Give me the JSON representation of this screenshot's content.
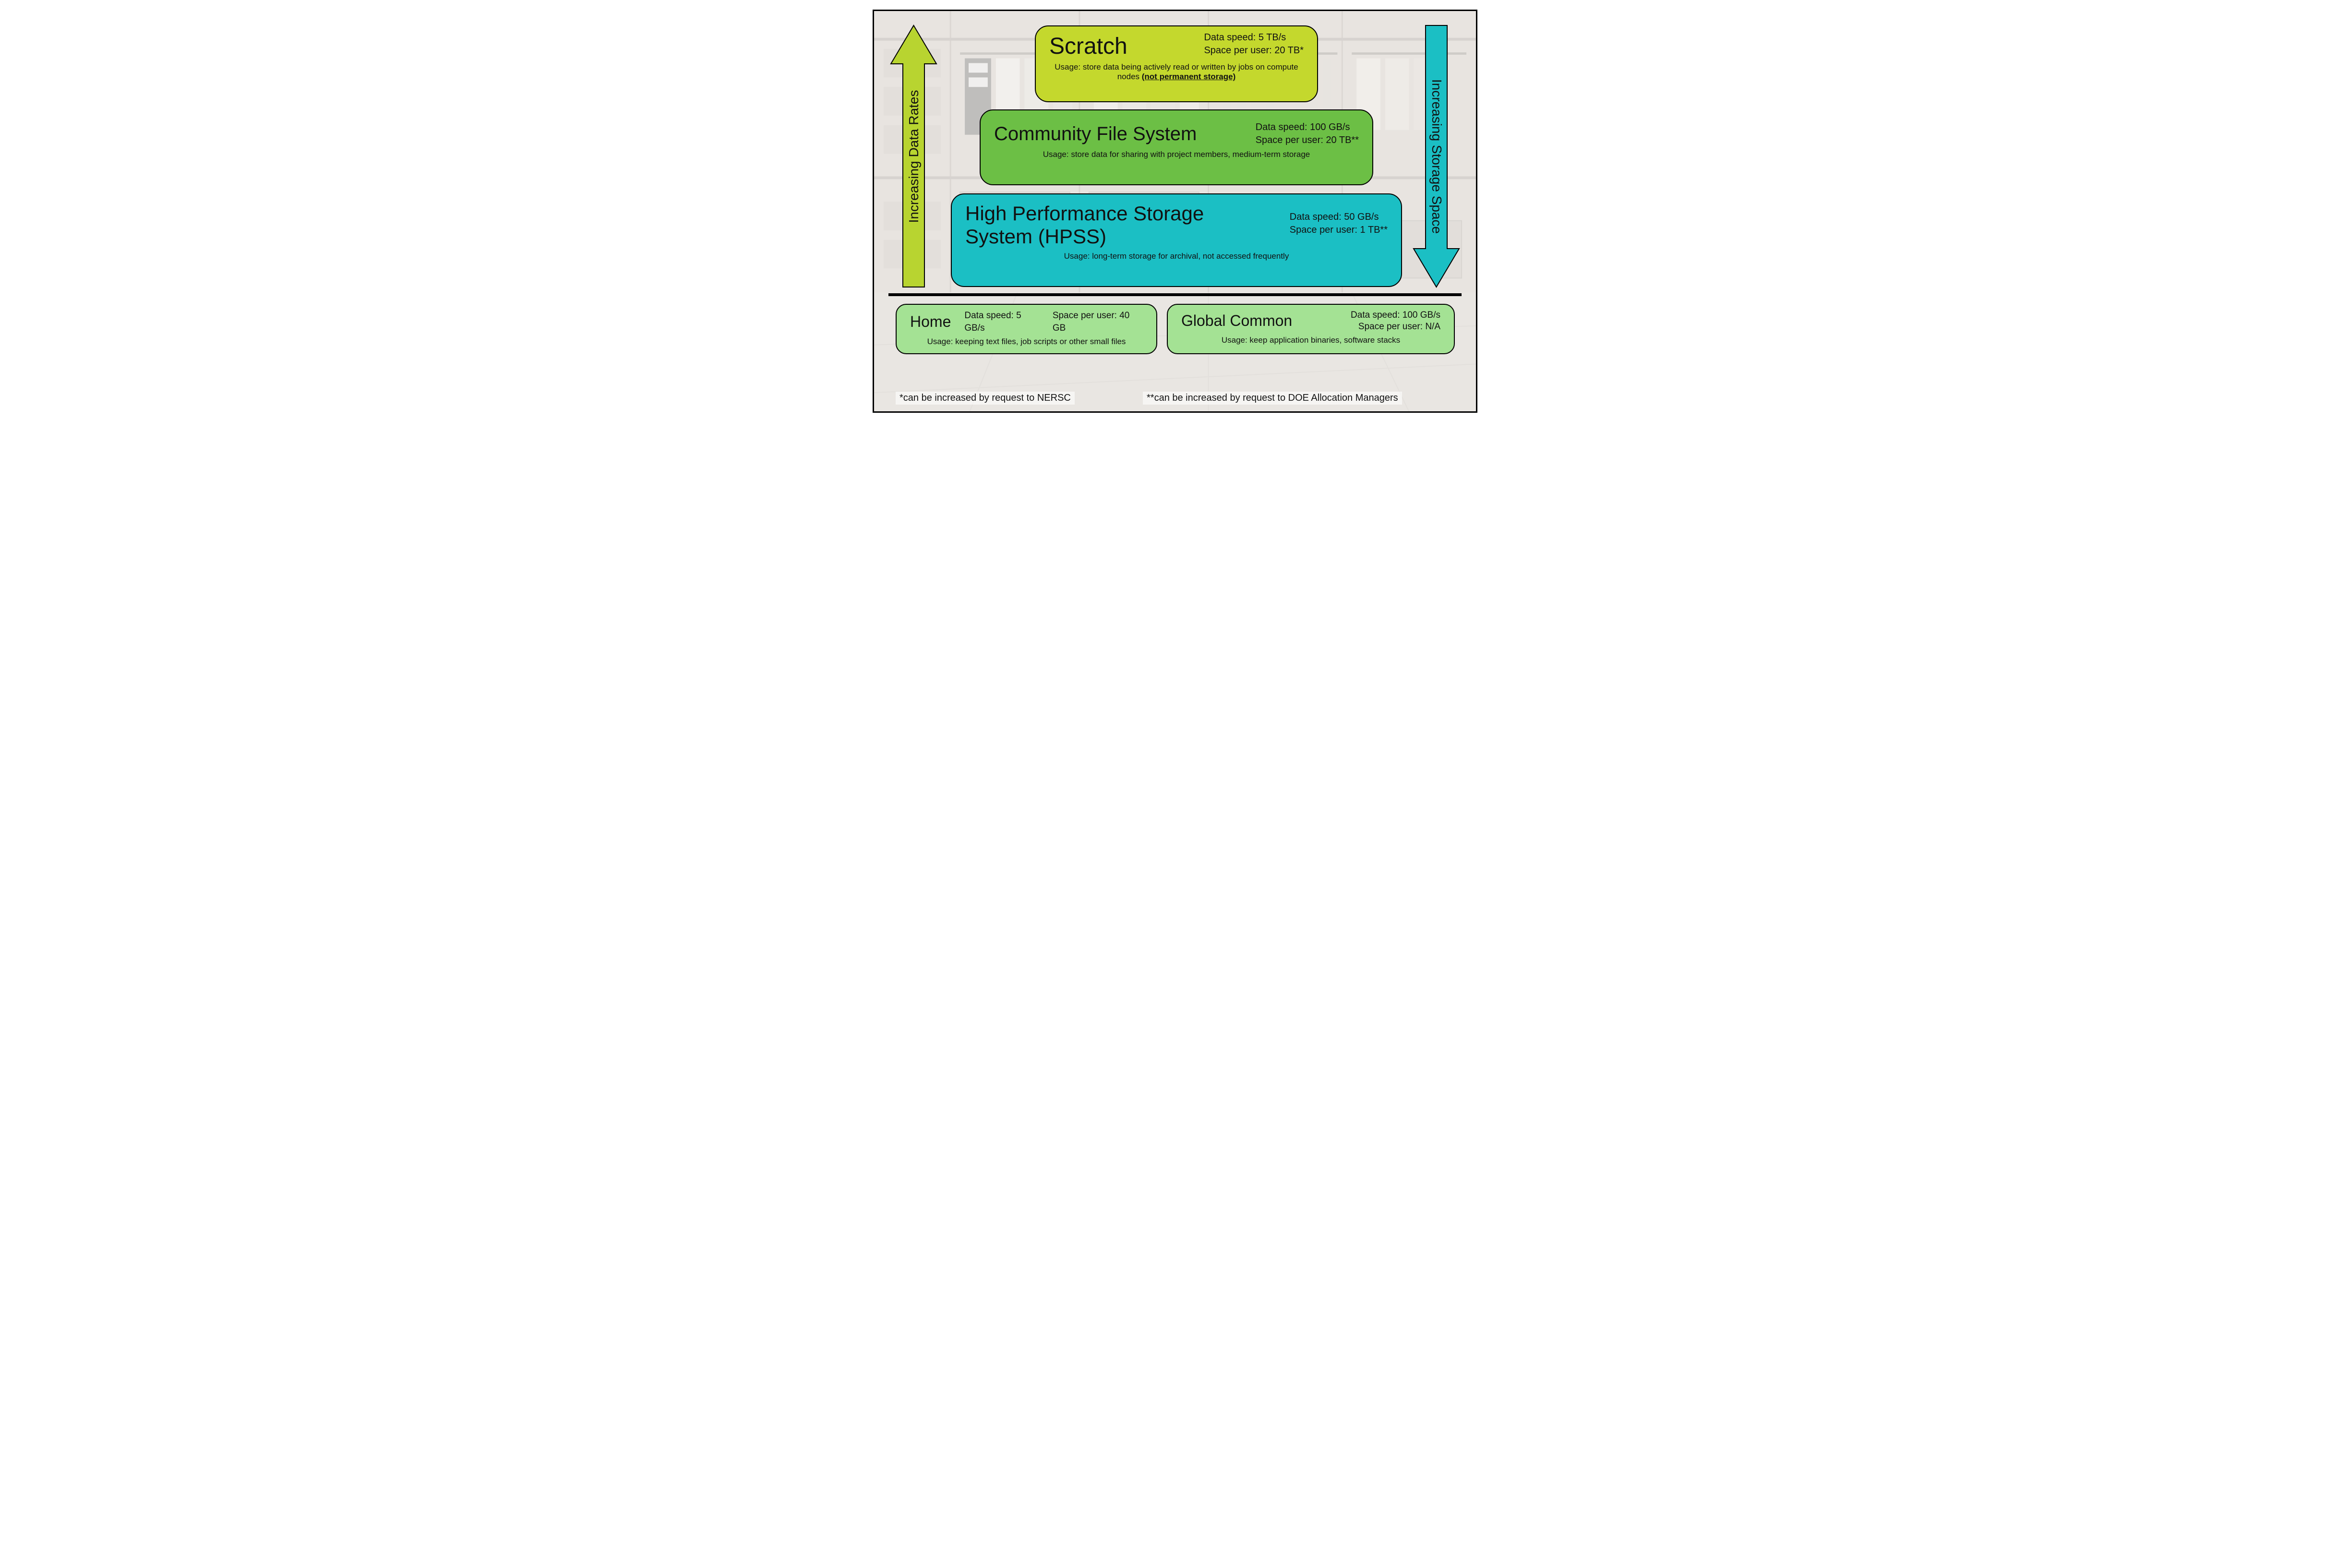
{
  "arrows": {
    "left_label": "Increasing Data Rates",
    "right_label": "Increasing Storage Space"
  },
  "tiers": {
    "scratch": {
      "title": "Scratch",
      "speed": "Data speed: 5 TB/s",
      "space": "Space per user: 20 TB*",
      "usage_prefix": "Usage: store data being actively read or written by jobs on compute nodes ",
      "usage_emph": "(not permanent storage)"
    },
    "cfs": {
      "title": "Community File System",
      "speed": "Data speed: 100 GB/s",
      "space": "Space per user: 20 TB**",
      "usage": "Usage: store data for sharing with project members, medium-term storage"
    },
    "hpss": {
      "title": "High Performance Storage System (HPSS)",
      "speed": "Data speed: 50 GB/s",
      "space": "Space per user: 1 TB**",
      "usage": "Usage: long-term storage for archival, not accessed frequently"
    },
    "home": {
      "title": "Home",
      "speed": "Data speed: 5 GB/s",
      "space": "Space per user: 40 GB",
      "usage": "Usage: keeping text files, job scripts or other small files"
    },
    "gcommon": {
      "title": "Global Common",
      "speed": "Data speed: 100 GB/s",
      "space": "Space per user: N/A",
      "usage": "Usage: keep application binaries, software stacks"
    }
  },
  "footnotes": {
    "single": "*can be increased by request to NERSC",
    "double": "**can be increased by request to DOE Allocation Managers"
  },
  "colors": {
    "scratch": "#c4d82d",
    "cfs": "#6cbf45",
    "hpss": "#1bbfc4",
    "home": "#a4e294",
    "arrow_left": "#b8d430",
    "arrow_right": "#1bbfc4"
  }
}
